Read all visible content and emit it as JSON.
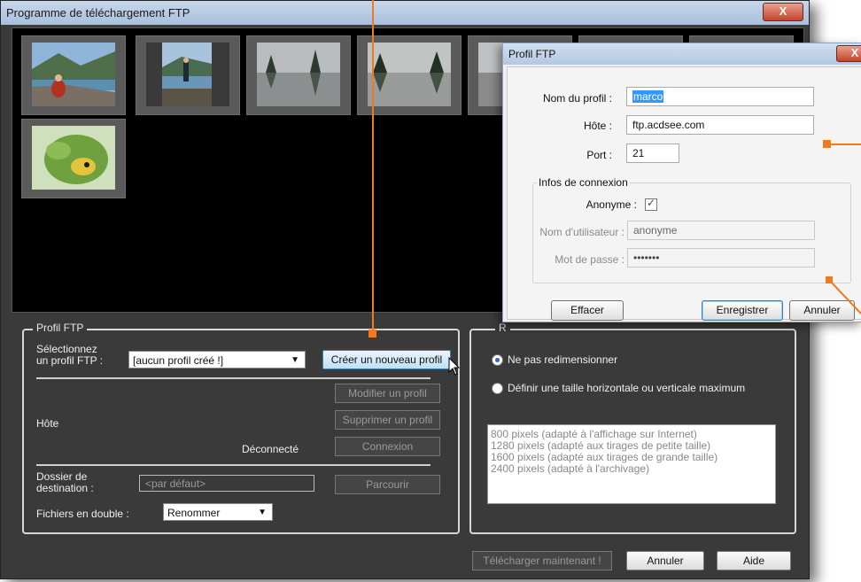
{
  "window": {
    "title": "Programme de téléchargement FTP",
    "close_label": "X"
  },
  "thumbnails": [
    {
      "name": "person-sitting-lake"
    },
    {
      "name": "person-standing-lake"
    },
    {
      "name": "lake-reflection-1"
    },
    {
      "name": "lake-reflection-2"
    },
    {
      "name": "lake-reflection-3"
    },
    {
      "name": "photo-6"
    },
    {
      "name": "photo-7"
    },
    {
      "name": "parrot"
    }
  ],
  "profile_section": {
    "legend": "Profil FTP",
    "select_label_line1": "Sélectionnez",
    "select_label_line2": "un profil FTP :",
    "select_value": "[aucun profil créé !]",
    "create_button": "Créer un nouveau profil",
    "modify_button": "Modifier un profil",
    "delete_button": "Supprimer un profil",
    "host_label": "Hôte",
    "status_text": "Déconnecté",
    "connect_button": "Connexion",
    "dest_label_line1": "Dossier de",
    "dest_label_line2": "destination :",
    "dest_placeholder": "<par défaut>",
    "browse_button": "Parcourir",
    "duplicates_label": "Fichiers en double :",
    "duplicates_value": "Renommer"
  },
  "resize_section": {
    "legend": "R",
    "option_no_resize": "Ne pas redimensionner",
    "option_max_size": "Définir une taille horizontale ou verticale maximum",
    "sizes": [
      "800 pixels (adapté à l'affichage sur Internet)",
      "1280 pixels (adapté aux tirages de petite taille)",
      "1600 pixels (adapté aux tirages de grande taille)",
      "2400 pixels (adapté à l'archivage)"
    ]
  },
  "footer": {
    "upload_button": "Télécharger maintenant !",
    "cancel_button": "Annuler",
    "help_button": "Aide"
  },
  "dialog": {
    "title": "Profil FTP",
    "close_label": "X",
    "profile_name_label": "Nom du profil :",
    "profile_name_value": "marco",
    "host_label": "Hôte :",
    "host_value": "ftp.acdsee.com",
    "port_label": "Port :",
    "port_value": "21",
    "connection_legend": "Infos de connexion",
    "anonymous_label": "Anonyme :",
    "anonymous_checked": "✓",
    "username_label": "Nom d'utilisateur :",
    "username_value": "anonyme",
    "password_label": "Mot de passe :",
    "password_value": "•••••••",
    "clear_button": "Effacer",
    "save_button": "Enregistrer",
    "cancel_button": "Annuler"
  },
  "colors": {
    "accent": "#f07a20",
    "window_bg": "#3a3a3a",
    "thumb_bg": "#000000"
  }
}
